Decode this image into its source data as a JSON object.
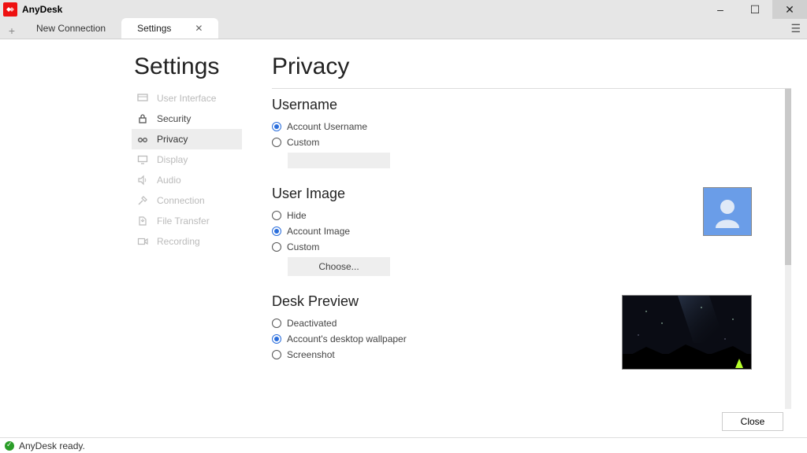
{
  "app": {
    "title": "AnyDesk"
  },
  "window_controls": {
    "minimize": "–",
    "maximize": "☐",
    "close": "✕"
  },
  "tabs": {
    "plus": "+",
    "items": [
      {
        "label": "New Connection",
        "active": false
      },
      {
        "label": "Settings",
        "active": true,
        "close": "✕"
      }
    ]
  },
  "settings_heading": "Settings",
  "nav": {
    "items": [
      {
        "key": "user-interface",
        "label": "User Interface",
        "icon": "ui",
        "enabled": false,
        "selected": false
      },
      {
        "key": "security",
        "label": "Security",
        "icon": "lock",
        "enabled": true,
        "selected": false
      },
      {
        "key": "privacy",
        "label": "Privacy",
        "icon": "glasses",
        "enabled": true,
        "selected": true
      },
      {
        "key": "display",
        "label": "Display",
        "icon": "monitor",
        "enabled": false,
        "selected": false
      },
      {
        "key": "audio",
        "label": "Audio",
        "icon": "speaker",
        "enabled": false,
        "selected": false
      },
      {
        "key": "connection",
        "label": "Connection",
        "icon": "plug",
        "enabled": false,
        "selected": false
      },
      {
        "key": "file-transfer",
        "label": "File Transfer",
        "icon": "file",
        "enabled": false,
        "selected": false
      },
      {
        "key": "recording",
        "label": "Recording",
        "icon": "rec",
        "enabled": false,
        "selected": false
      }
    ]
  },
  "page": {
    "title": "Privacy",
    "sections": {
      "username": {
        "title": "Username",
        "options": [
          {
            "label": "Account Username",
            "selected": true
          },
          {
            "label": "Custom",
            "selected": false
          }
        ]
      },
      "user_image": {
        "title": "User Image",
        "options": [
          {
            "label": "Hide",
            "selected": false
          },
          {
            "label": "Account Image",
            "selected": true
          },
          {
            "label": "Custom",
            "selected": false
          }
        ],
        "choose_button": "Choose..."
      },
      "desk_preview": {
        "title": "Desk Preview",
        "options": [
          {
            "label": "Deactivated",
            "selected": false
          },
          {
            "label": "Account's desktop wallpaper",
            "selected": true
          },
          {
            "label": "Screenshot",
            "selected": false
          }
        ]
      }
    },
    "close_button": "Close"
  },
  "status": {
    "text": "AnyDesk ready."
  }
}
